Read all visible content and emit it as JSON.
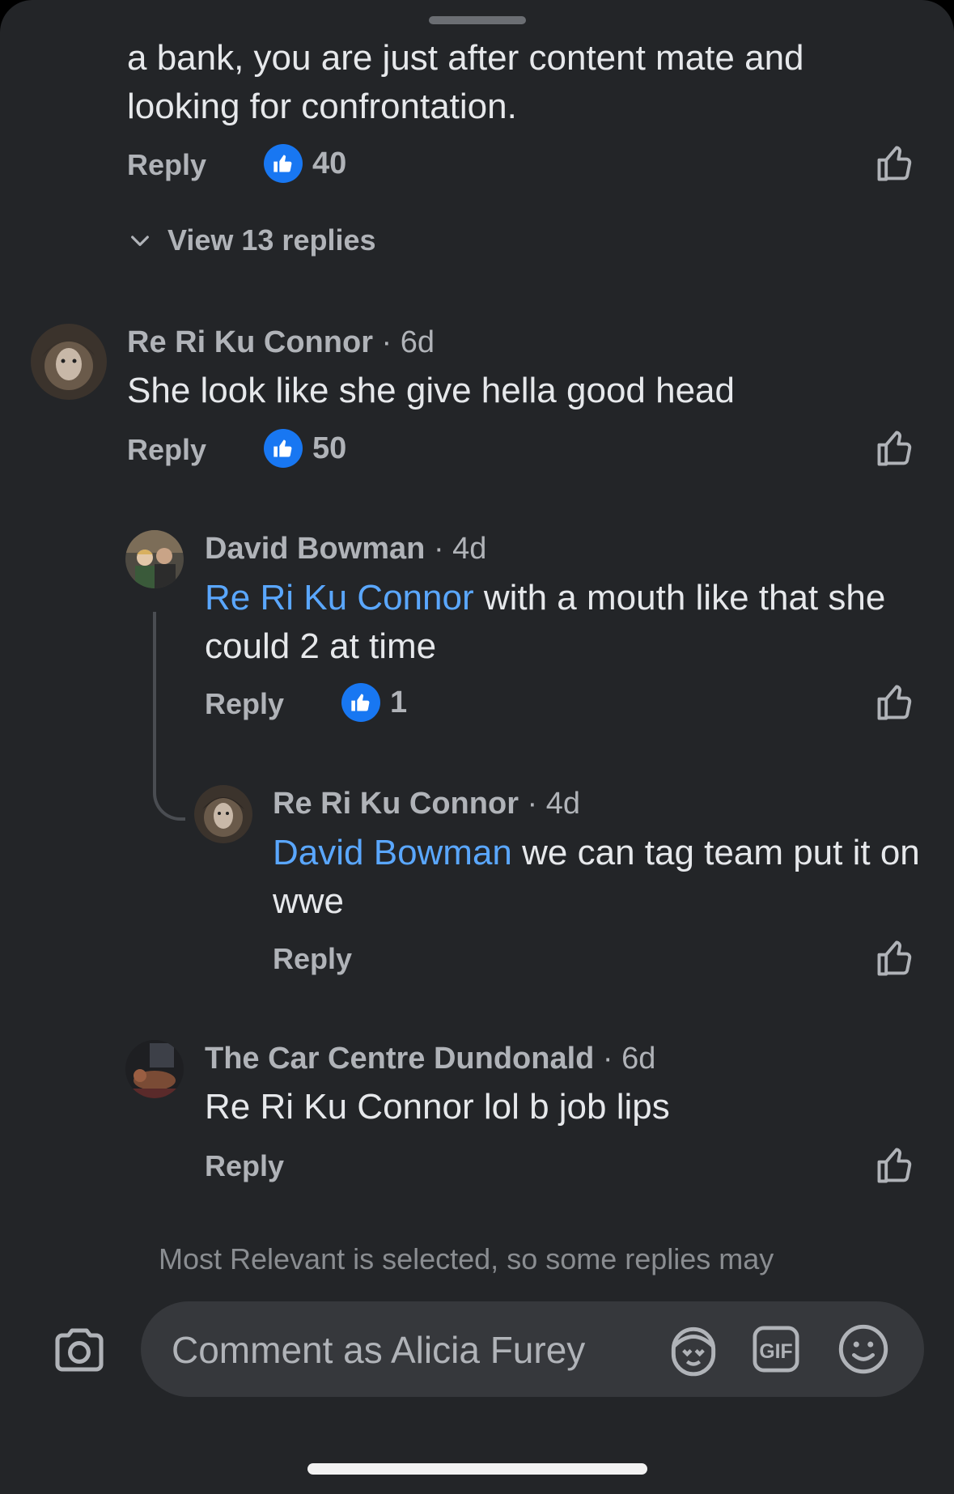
{
  "comments": {
    "top": {
      "text": "a bank, you are just after content mate and looking for confrontation.",
      "reply_label": "Reply",
      "like_count": "40",
      "view_replies": "View 13 replies"
    },
    "c1": {
      "author": "Re Ri Ku Connor",
      "time": " · 6d",
      "text": "She look like she give hella good head",
      "reply_label": "Reply",
      "like_count": "50"
    },
    "r1": {
      "author": "David Bowman",
      "time": " · 4d",
      "mention": "Re Ri Ku Connor",
      "text": " with a mouth like that she could 2 at time",
      "reply_label": "Reply",
      "like_count": "1"
    },
    "r2": {
      "author": "Re Ri Ku Connor",
      "time": " · 4d",
      "mention": "David Bowman",
      "text": " we can tag team put it on wwe",
      "reply_label": "Reply"
    },
    "r3": {
      "author": "The Car Centre Dundonald",
      "time": " · 6d",
      "text": "Re Ri Ku Connor lol b job lips",
      "reply_label": "Reply"
    }
  },
  "notice": "Most Relevant is selected, so some replies may",
  "composer": {
    "placeholder": "Comment as Alicia Furey"
  },
  "colors": {
    "accent": "#1877f2",
    "mention": "#5aa7ff",
    "background": "#232528"
  }
}
